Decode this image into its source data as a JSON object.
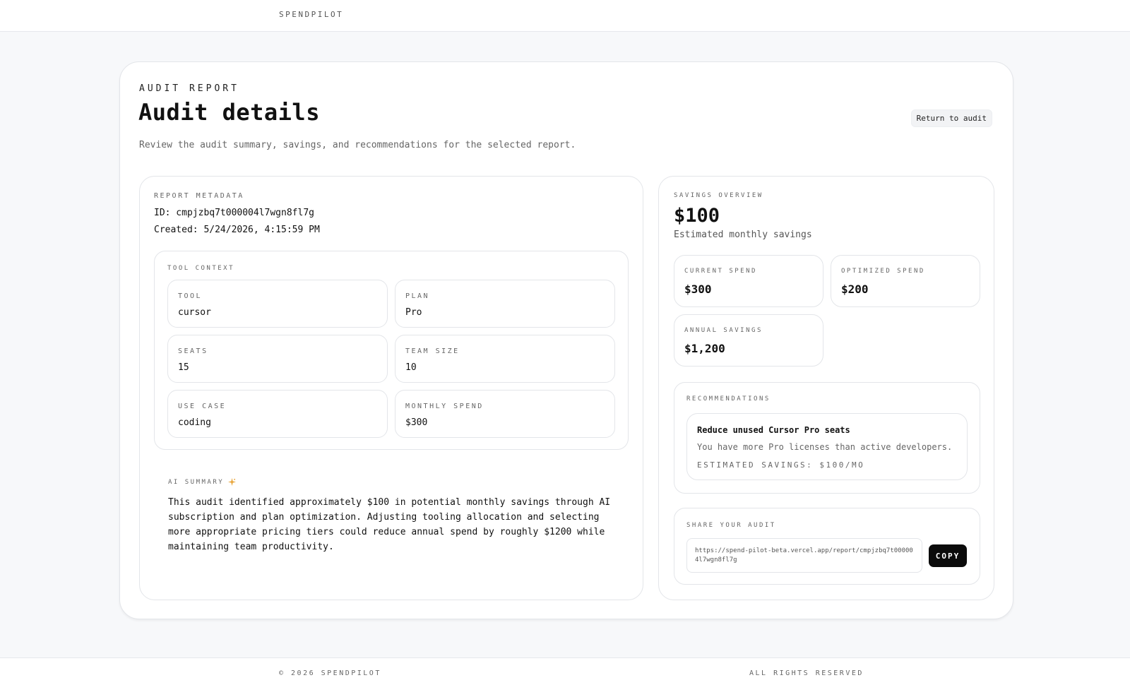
{
  "header": {
    "brand": "SPENDPILOT"
  },
  "page": {
    "eyebrow": "AUDIT REPORT",
    "title": "Audit details",
    "subtitle": "Review the audit summary, savings, and recommendations for the selected report.",
    "return_label": "Return to audit"
  },
  "metadata": {
    "label": "REPORT METADATA",
    "id_text": "ID: cmpjzbq7t000004l7wgn8fl7g",
    "created_text": "Created: 5/24/2026, 4:15:59 PM"
  },
  "tool_context": {
    "label": "TOOL CONTEXT",
    "fields": [
      {
        "label": "TOOL",
        "value": "cursor"
      },
      {
        "label": "PLAN",
        "value": "Pro"
      },
      {
        "label": "SEATS",
        "value": "15"
      },
      {
        "label": "TEAM SIZE",
        "value": "10"
      },
      {
        "label": "USE CASE",
        "value": "coding"
      },
      {
        "label": "MONTHLY SPEND",
        "value": "$300"
      }
    ]
  },
  "ai_summary": {
    "label": "AI SUMMARY",
    "icon": "sparkle-icon",
    "text": "This audit identified approximately $100 in potential monthly savings through AI subscription and plan optimization. Adjusting tooling allocation and selecting more appropriate pricing tiers could reduce annual spend by roughly $1200 while maintaining team productivity."
  },
  "savings": {
    "label": "SAVINGS OVERVIEW",
    "amount": "$100",
    "caption": "Estimated monthly savings",
    "cards": [
      {
        "label": "CURRENT SPEND",
        "value": "$300"
      },
      {
        "label": "OPTIMIZED SPEND",
        "value": "$200"
      },
      {
        "label": "ANNUAL SAVINGS",
        "value": "$1,200"
      }
    ]
  },
  "recommendations": {
    "label": "RECOMMENDATIONS",
    "items": [
      {
        "title": "Reduce unused Cursor Pro seats",
        "description": "You have more Pro licenses than active developers.",
        "savings": "ESTIMATED SAVINGS: $100/MO"
      }
    ]
  },
  "share": {
    "label": "SHARE YOUR AUDIT",
    "url": "https://spend-pilot-beta.vercel.app/report/cmpjzbq7t000004l7wgn8fl7g",
    "copy_label": "COPY"
  },
  "footer": {
    "copyright": "© 2026 SPENDPILOT",
    "rights": "ALL RIGHTS RESERVED"
  },
  "colors": {
    "background": "#f7f8fa",
    "card": "#ffffff",
    "border": "#e3e5e9",
    "text": "#111111",
    "muted": "#666666",
    "sparkle": "#e8a53a",
    "button": "#0b0b0b"
  }
}
